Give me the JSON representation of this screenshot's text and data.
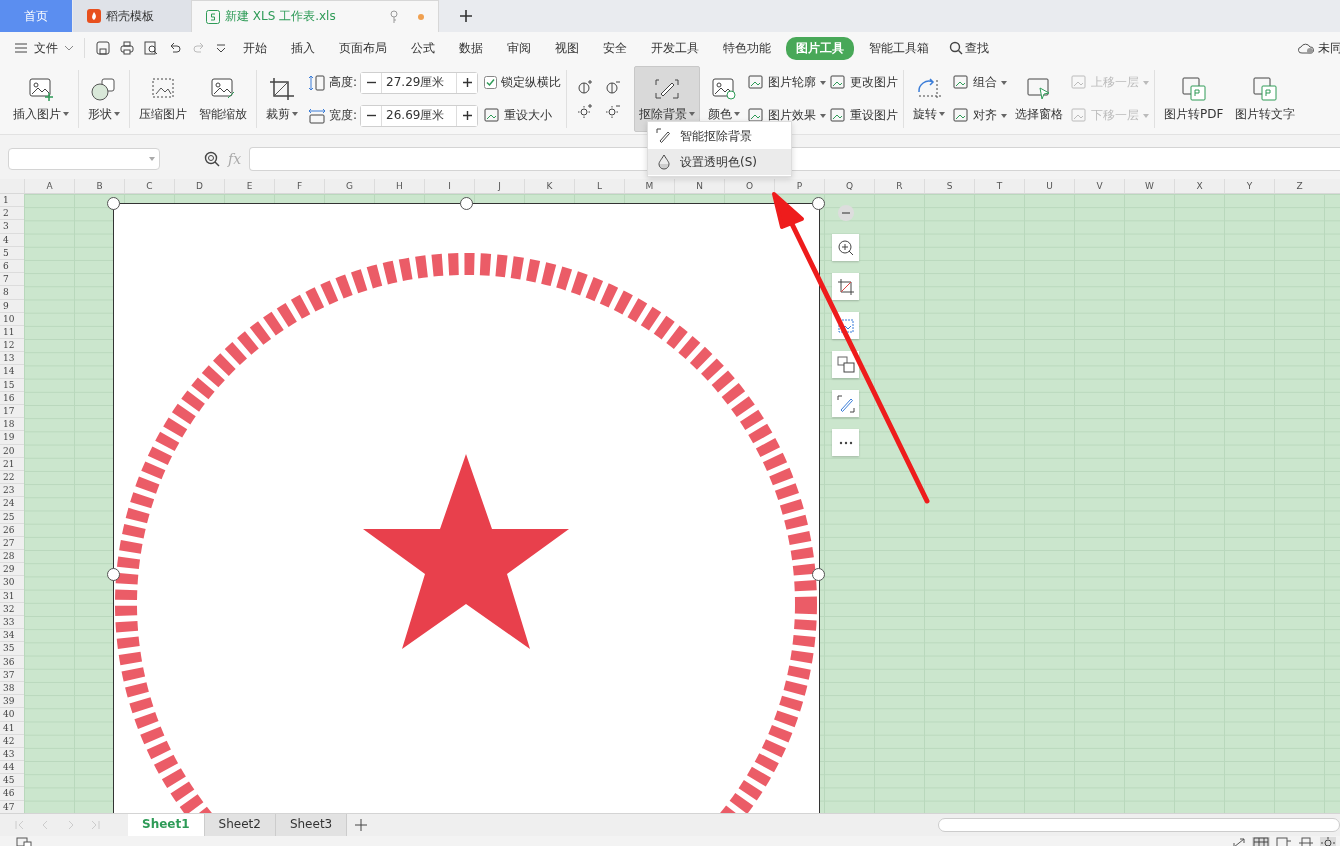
{
  "tabs": [
    {
      "label": "首页",
      "selected": false,
      "kind": "home"
    },
    {
      "label": "稻壳模板",
      "selected": false,
      "kind": "docer"
    },
    {
      "label": "新建 XLS 工作表.xls",
      "selected": true,
      "kind": "sheet"
    }
  ],
  "menu": {
    "file": "文件",
    "items": [
      {
        "label": "开始",
        "selected": false
      },
      {
        "label": "插入",
        "selected": false
      },
      {
        "label": "页面布局",
        "selected": false
      },
      {
        "label": "公式",
        "selected": false
      },
      {
        "label": "数据",
        "selected": false
      },
      {
        "label": "审阅",
        "selected": false
      },
      {
        "label": "视图",
        "selected": false
      },
      {
        "label": "安全",
        "selected": false
      },
      {
        "label": "开发工具",
        "selected": false
      },
      {
        "label": "特色功能",
        "selected": false
      },
      {
        "label": "图片工具",
        "selected": true
      },
      {
        "label": "智能工具箱",
        "selected": false
      }
    ],
    "search": "查找",
    "sync": "未同"
  },
  "ribbon": {
    "groups": [
      {
        "columns": [
          {
            "kind": "large",
            "label": "插入图片",
            "dropdown": true,
            "pressed": false
          }
        ]
      },
      {
        "columns": [
          {
            "kind": "large",
            "label": "形状",
            "dropdown": true,
            "pressed": false
          }
        ]
      },
      {
        "columns": [
          {
            "kind": "large",
            "label": "压缩图片",
            "dropdown": false,
            "pressed": false
          },
          {
            "kind": "large",
            "label": "智能缩放",
            "dropdown": false,
            "pressed": false
          }
        ]
      },
      {
        "columns": [
          {
            "kind": "large",
            "label": "裁剪",
            "dropdown": true,
            "pressed": false
          },
          {
            "kind": "size",
            "rows": [
              {
                "label": "高度:",
                "value": "27.29厘米"
              },
              {
                "label": "宽度:",
                "value": "26.69厘米"
              }
            ]
          },
          {
            "kind": "stack",
            "items": [
              {
                "kind": "check",
                "label": "锁定纵横比",
                "checked": true
              },
              {
                "kind": "button",
                "label": "重设大小",
                "dropdown": false,
                "disabled": false
              }
            ]
          }
        ]
      },
      {
        "columns": [
          {
            "kind": "adjust"
          },
          {
            "kind": "large",
            "label": "抠除背景",
            "dropdown": true,
            "pressed": true
          },
          {
            "kind": "large",
            "label": "颜色",
            "dropdown": true,
            "pressed": false
          },
          {
            "kind": "stack",
            "items": [
              {
                "kind": "button",
                "label": "图片轮廓",
                "dropdown": true,
                "disabled": false
              },
              {
                "kind": "button",
                "label": "图片效果",
                "dropdown": true,
                "disabled": false
              }
            ]
          },
          {
            "kind": "stack",
            "items": [
              {
                "kind": "button",
                "label": "更改图片",
                "dropdown": false,
                "disabled": false
              },
              {
                "kind": "button",
                "label": "重设图片",
                "dropdown": false,
                "disabled": false
              }
            ]
          }
        ]
      },
      {
        "columns": [
          {
            "kind": "large",
            "label": "旋转",
            "dropdown": true,
            "pressed": false
          },
          {
            "kind": "stack",
            "items": [
              {
                "kind": "button",
                "label": "组合",
                "dropdown": true,
                "disabled": false
              },
              {
                "kind": "button",
                "label": "对齐",
                "dropdown": true,
                "disabled": false
              }
            ]
          },
          {
            "kind": "large",
            "label": "选择窗格",
            "dropdown": false,
            "pressed": false
          },
          {
            "kind": "stack",
            "items": [
              {
                "kind": "button",
                "label": "上移一层",
                "dropdown": true,
                "disabled": true
              },
              {
                "kind": "button",
                "label": "下移一层",
                "dropdown": true,
                "disabled": true
              }
            ]
          }
        ]
      },
      {
        "columns": [
          {
            "kind": "large",
            "label": "图片转PDF",
            "dropdown": false,
            "pressed": false
          },
          {
            "kind": "large",
            "label": "图片转文字",
            "dropdown": false,
            "pressed": false
          }
        ]
      }
    ]
  },
  "dropdown_menu": [
    {
      "label": "智能抠除背景",
      "selected": false
    },
    {
      "label": "设置透明色(S)",
      "selected": true
    }
  ],
  "formula_bar": {
    "fx": "fx"
  },
  "columns": [
    "A",
    "B",
    "C",
    "D",
    "E",
    "F",
    "G",
    "H",
    "I",
    "J",
    "K",
    "L",
    "M",
    "N",
    "O",
    "P",
    "Q",
    "R",
    "S",
    "T",
    "U",
    "V",
    "W",
    "X",
    "Y",
    "Z"
  ],
  "rows": [
    "1",
    "2",
    "3",
    "4",
    "5",
    "6",
    "7",
    "8",
    "9",
    "10",
    "11",
    "12",
    "13",
    "14",
    "15",
    "16",
    "17",
    "18",
    "19",
    "20",
    "21",
    "22",
    "23",
    "24",
    "25",
    "26",
    "27",
    "28",
    "29",
    "30",
    "31",
    "32",
    "33",
    "34",
    "35",
    "36",
    "37",
    "38",
    "39",
    "40",
    "41",
    "42",
    "43",
    "44",
    "45",
    "46",
    "47"
  ],
  "sheets": [
    {
      "label": "Sheet1",
      "selected": true
    },
    {
      "label": "Sheet2",
      "selected": false
    },
    {
      "label": "Sheet3",
      "selected": false
    }
  ]
}
